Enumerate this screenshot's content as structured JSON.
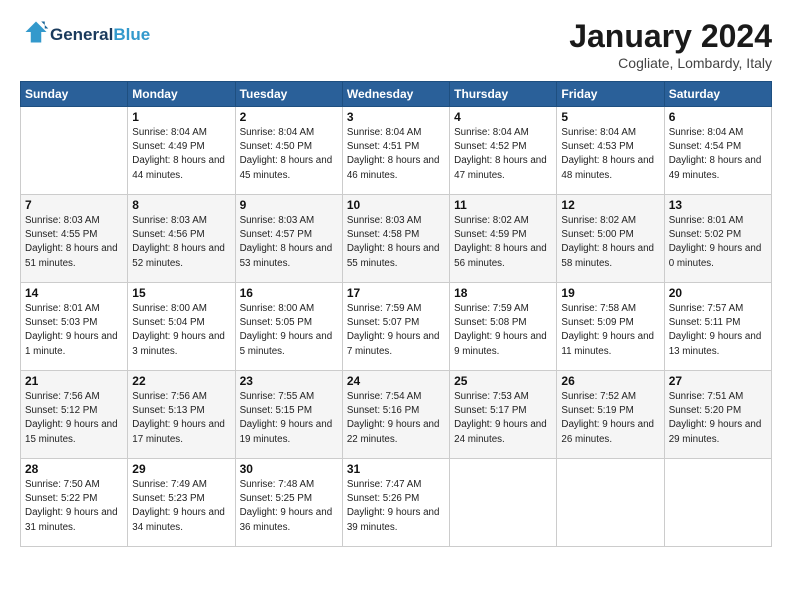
{
  "header": {
    "logo_line1": "General",
    "logo_line2": "Blue",
    "month_title": "January 2024",
    "subtitle": "Cogliate, Lombardy, Italy"
  },
  "weekdays": [
    "Sunday",
    "Monday",
    "Tuesday",
    "Wednesday",
    "Thursday",
    "Friday",
    "Saturday"
  ],
  "weeks": [
    [
      {
        "day": "",
        "sunrise": "",
        "sunset": "",
        "daylight": ""
      },
      {
        "day": "1",
        "sunrise": "Sunrise: 8:04 AM",
        "sunset": "Sunset: 4:49 PM",
        "daylight": "Daylight: 8 hours and 44 minutes."
      },
      {
        "day": "2",
        "sunrise": "Sunrise: 8:04 AM",
        "sunset": "Sunset: 4:50 PM",
        "daylight": "Daylight: 8 hours and 45 minutes."
      },
      {
        "day": "3",
        "sunrise": "Sunrise: 8:04 AM",
        "sunset": "Sunset: 4:51 PM",
        "daylight": "Daylight: 8 hours and 46 minutes."
      },
      {
        "day": "4",
        "sunrise": "Sunrise: 8:04 AM",
        "sunset": "Sunset: 4:52 PM",
        "daylight": "Daylight: 8 hours and 47 minutes."
      },
      {
        "day": "5",
        "sunrise": "Sunrise: 8:04 AM",
        "sunset": "Sunset: 4:53 PM",
        "daylight": "Daylight: 8 hours and 48 minutes."
      },
      {
        "day": "6",
        "sunrise": "Sunrise: 8:04 AM",
        "sunset": "Sunset: 4:54 PM",
        "daylight": "Daylight: 8 hours and 49 minutes."
      }
    ],
    [
      {
        "day": "7",
        "sunrise": "Sunrise: 8:03 AM",
        "sunset": "Sunset: 4:55 PM",
        "daylight": "Daylight: 8 hours and 51 minutes."
      },
      {
        "day": "8",
        "sunrise": "Sunrise: 8:03 AM",
        "sunset": "Sunset: 4:56 PM",
        "daylight": "Daylight: 8 hours and 52 minutes."
      },
      {
        "day": "9",
        "sunrise": "Sunrise: 8:03 AM",
        "sunset": "Sunset: 4:57 PM",
        "daylight": "Daylight: 8 hours and 53 minutes."
      },
      {
        "day": "10",
        "sunrise": "Sunrise: 8:03 AM",
        "sunset": "Sunset: 4:58 PM",
        "daylight": "Daylight: 8 hours and 55 minutes."
      },
      {
        "day": "11",
        "sunrise": "Sunrise: 8:02 AM",
        "sunset": "Sunset: 4:59 PM",
        "daylight": "Daylight: 8 hours and 56 minutes."
      },
      {
        "day": "12",
        "sunrise": "Sunrise: 8:02 AM",
        "sunset": "Sunset: 5:00 PM",
        "daylight": "Daylight: 8 hours and 58 minutes."
      },
      {
        "day": "13",
        "sunrise": "Sunrise: 8:01 AM",
        "sunset": "Sunset: 5:02 PM",
        "daylight": "Daylight: 9 hours and 0 minutes."
      }
    ],
    [
      {
        "day": "14",
        "sunrise": "Sunrise: 8:01 AM",
        "sunset": "Sunset: 5:03 PM",
        "daylight": "Daylight: 9 hours and 1 minute."
      },
      {
        "day": "15",
        "sunrise": "Sunrise: 8:00 AM",
        "sunset": "Sunset: 5:04 PM",
        "daylight": "Daylight: 9 hours and 3 minutes."
      },
      {
        "day": "16",
        "sunrise": "Sunrise: 8:00 AM",
        "sunset": "Sunset: 5:05 PM",
        "daylight": "Daylight: 9 hours and 5 minutes."
      },
      {
        "day": "17",
        "sunrise": "Sunrise: 7:59 AM",
        "sunset": "Sunset: 5:07 PM",
        "daylight": "Daylight: 9 hours and 7 minutes."
      },
      {
        "day": "18",
        "sunrise": "Sunrise: 7:59 AM",
        "sunset": "Sunset: 5:08 PM",
        "daylight": "Daylight: 9 hours and 9 minutes."
      },
      {
        "day": "19",
        "sunrise": "Sunrise: 7:58 AM",
        "sunset": "Sunset: 5:09 PM",
        "daylight": "Daylight: 9 hours and 11 minutes."
      },
      {
        "day": "20",
        "sunrise": "Sunrise: 7:57 AM",
        "sunset": "Sunset: 5:11 PM",
        "daylight": "Daylight: 9 hours and 13 minutes."
      }
    ],
    [
      {
        "day": "21",
        "sunrise": "Sunrise: 7:56 AM",
        "sunset": "Sunset: 5:12 PM",
        "daylight": "Daylight: 9 hours and 15 minutes."
      },
      {
        "day": "22",
        "sunrise": "Sunrise: 7:56 AM",
        "sunset": "Sunset: 5:13 PM",
        "daylight": "Daylight: 9 hours and 17 minutes."
      },
      {
        "day": "23",
        "sunrise": "Sunrise: 7:55 AM",
        "sunset": "Sunset: 5:15 PM",
        "daylight": "Daylight: 9 hours and 19 minutes."
      },
      {
        "day": "24",
        "sunrise": "Sunrise: 7:54 AM",
        "sunset": "Sunset: 5:16 PM",
        "daylight": "Daylight: 9 hours and 22 minutes."
      },
      {
        "day": "25",
        "sunrise": "Sunrise: 7:53 AM",
        "sunset": "Sunset: 5:17 PM",
        "daylight": "Daylight: 9 hours and 24 minutes."
      },
      {
        "day": "26",
        "sunrise": "Sunrise: 7:52 AM",
        "sunset": "Sunset: 5:19 PM",
        "daylight": "Daylight: 9 hours and 26 minutes."
      },
      {
        "day": "27",
        "sunrise": "Sunrise: 7:51 AM",
        "sunset": "Sunset: 5:20 PM",
        "daylight": "Daylight: 9 hours and 29 minutes."
      }
    ],
    [
      {
        "day": "28",
        "sunrise": "Sunrise: 7:50 AM",
        "sunset": "Sunset: 5:22 PM",
        "daylight": "Daylight: 9 hours and 31 minutes."
      },
      {
        "day": "29",
        "sunrise": "Sunrise: 7:49 AM",
        "sunset": "Sunset: 5:23 PM",
        "daylight": "Daylight: 9 hours and 34 minutes."
      },
      {
        "day": "30",
        "sunrise": "Sunrise: 7:48 AM",
        "sunset": "Sunset: 5:25 PM",
        "daylight": "Daylight: 9 hours and 36 minutes."
      },
      {
        "day": "31",
        "sunrise": "Sunrise: 7:47 AM",
        "sunset": "Sunset: 5:26 PM",
        "daylight": "Daylight: 9 hours and 39 minutes."
      },
      {
        "day": "",
        "sunrise": "",
        "sunset": "",
        "daylight": ""
      },
      {
        "day": "",
        "sunrise": "",
        "sunset": "",
        "daylight": ""
      },
      {
        "day": "",
        "sunrise": "",
        "sunset": "",
        "daylight": ""
      }
    ]
  ]
}
